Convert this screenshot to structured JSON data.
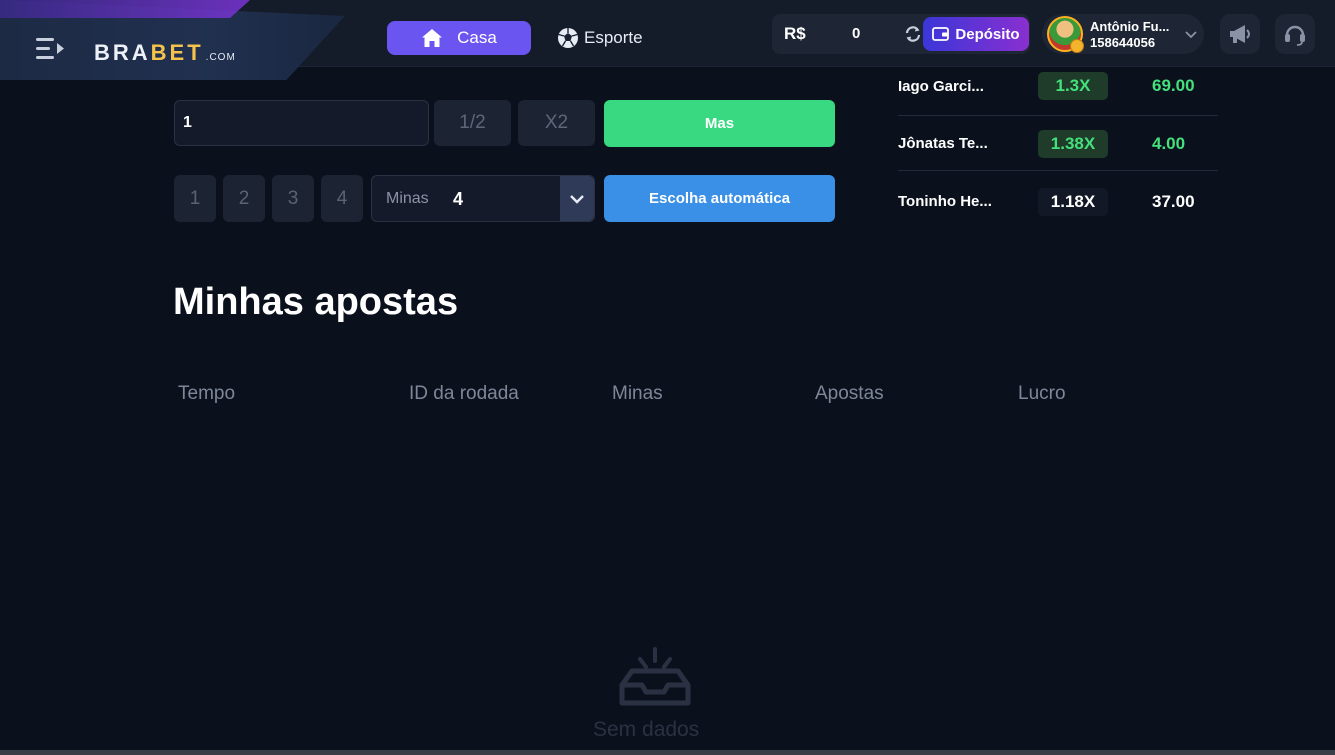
{
  "header": {
    "brand_main": "BRA",
    "brand_accent": "BET",
    "brand_suffix": ".COM",
    "nav": [
      {
        "label": "Casa",
        "icon": "home-icon",
        "active": true
      },
      {
        "label": "Esporte",
        "icon": "soccer-ball-icon",
        "active": false
      }
    ],
    "wallet": {
      "currency": "R$",
      "balance": "0",
      "deposit_label": "Depósito"
    },
    "user": {
      "name": "Antônio Fu...",
      "id": "158644056"
    }
  },
  "bet": {
    "amount": "1",
    "half_label": "1/2",
    "double_label": "X2",
    "more_label": "Mas",
    "mine_presets": [
      "1",
      "2",
      "3",
      "4"
    ],
    "mines_label": "Minas",
    "mines_value": "4",
    "auto_label": "Escolha automática"
  },
  "leaderboard": [
    {
      "name": "Iago Garci...",
      "multiplier": "1.3X",
      "amount": "69.00",
      "win": true
    },
    {
      "name": "Jônatas Te...",
      "multiplier": "1.38X",
      "amount": "4.00",
      "win": true
    },
    {
      "name": "Toninho He...",
      "multiplier": "1.18X",
      "amount": "37.00",
      "win": false
    }
  ],
  "my_bets": {
    "title": "Minhas apostas",
    "columns": [
      "Tempo",
      "ID da rodada",
      "Minas",
      "Apostas",
      "Lucro"
    ],
    "empty_text": "Sem dados"
  },
  "colors": {
    "background": "#0b111c",
    "accent_purple": "#6b55f0",
    "green": "#39d982",
    "blue": "#3a8fe6",
    "win_text": "#44e07c"
  }
}
